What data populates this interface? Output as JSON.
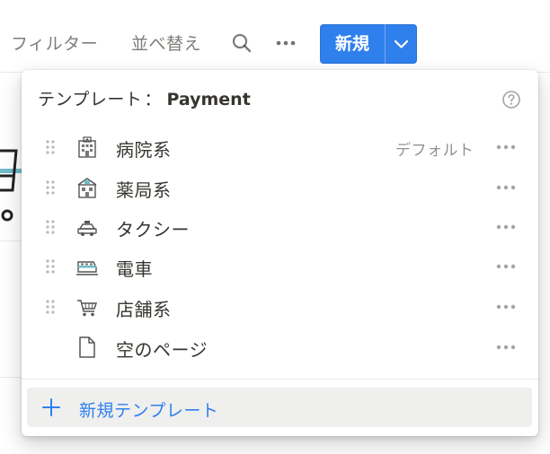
{
  "toolbar": {
    "filter_label": "フィルター",
    "sort_label": "並べ替え",
    "new_label": "新規"
  },
  "menu": {
    "title_prefix": "テンプレート",
    "title_colon": "：",
    "database_name": "Payment",
    "items": [
      {
        "label": "病院系",
        "icon": "hospital-icon",
        "badge": "デフォルト"
      },
      {
        "label": "薬局系",
        "icon": "pharmacy-icon"
      },
      {
        "label": "タクシー",
        "icon": "taxi-icon"
      },
      {
        "label": "電車",
        "icon": "train-icon"
      },
      {
        "label": "店舗系",
        "icon": "shopping-cart-icon"
      },
      {
        "label": "空のページ",
        "icon": "blank-page-icon"
      }
    ],
    "new_template_label": "新規テンプレート"
  },
  "colors": {
    "accent": "#2f80ed",
    "text": "#37352f",
    "hover_bg": "#efefee"
  }
}
